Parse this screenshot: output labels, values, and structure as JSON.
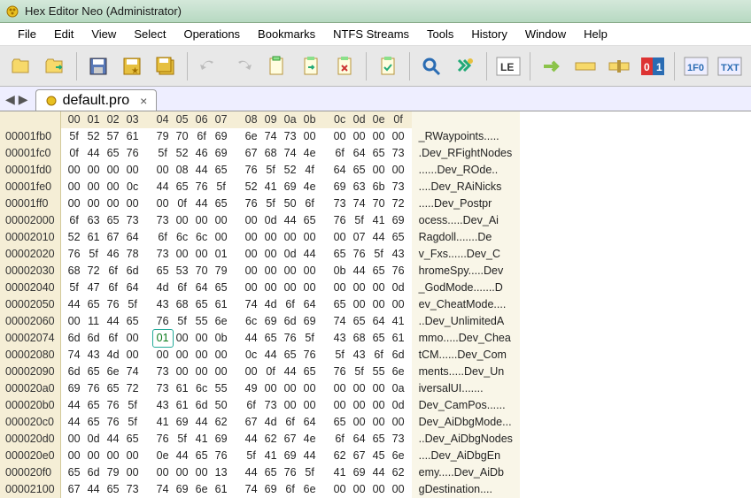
{
  "title": "Hex Editor Neo (Administrator)",
  "menu": [
    "File",
    "Edit",
    "View",
    "Select",
    "Operations",
    "Bookmarks",
    "NTFS Streams",
    "Tools",
    "History",
    "Window",
    "Help"
  ],
  "tab": {
    "label": "default.pro"
  },
  "col_headers": [
    "00",
    "01",
    "02",
    "03",
    "04",
    "05",
    "06",
    "07",
    "08",
    "09",
    "0a",
    "0b",
    "0c",
    "0d",
    "0e",
    "0f"
  ],
  "selected": {
    "row": 11,
    "col": 4
  },
  "rows": [
    {
      "o": "00001fb0",
      "h": [
        "5f",
        "52",
        "57",
        "61",
        "79",
        "70",
        "6f",
        "69",
        "6e",
        "74",
        "73",
        "00",
        "00",
        "00",
        "00",
        "00"
      ],
      "a": "_RWaypoints....."
    },
    {
      "o": "00001fc0",
      "h": [
        "0f",
        "44",
        "65",
        "76",
        "5f",
        "52",
        "46",
        "69",
        "67",
        "68",
        "74",
        "4e",
        "6f",
        "64",
        "65",
        "73"
      ],
      "a": ".Dev_RFightNodes"
    },
    {
      "o": "00001fd0",
      "h": [
        "00",
        "00",
        "00",
        "00",
        "00",
        "08",
        "44",
        "65",
        "76",
        "5f",
        "52",
        "4f",
        "64",
        "65",
        "00",
        "00"
      ],
      "a": "......Dev_ROde.."
    },
    {
      "o": "00001fe0",
      "h": [
        "00",
        "00",
        "00",
        "0c",
        "44",
        "65",
        "76",
        "5f",
        "52",
        "41",
        "69",
        "4e",
        "69",
        "63",
        "6b",
        "73"
      ],
      "a": "....Dev_RAiNicks"
    },
    {
      "o": "00001ff0",
      "h": [
        "00",
        "00",
        "00",
        "00",
        "00",
        "0f",
        "44",
        "65",
        "76",
        "5f",
        "50",
        "6f",
        "73",
        "74",
        "70",
        "72"
      ],
      "a": ".....Dev_Postpr"
    },
    {
      "o": "00002000",
      "h": [
        "6f",
        "63",
        "65",
        "73",
        "73",
        "00",
        "00",
        "00",
        "00",
        "0d",
        "44",
        "65",
        "76",
        "5f",
        "41",
        "69"
      ],
      "a": "ocess.....Dev_Ai"
    },
    {
      "o": "00002010",
      "h": [
        "52",
        "61",
        "67",
        "64",
        "6f",
        "6c",
        "6c",
        "00",
        "00",
        "00",
        "00",
        "00",
        "00",
        "07",
        "44",
        "65"
      ],
      "a": "Ragdoll.......De"
    },
    {
      "o": "00002020",
      "h": [
        "76",
        "5f",
        "46",
        "78",
        "73",
        "00",
        "00",
        "01",
        "00",
        "00",
        "0d",
        "44",
        "65",
        "76",
        "5f",
        "43"
      ],
      "a": "v_Fxs......Dev_C"
    },
    {
      "o": "00002030",
      "h": [
        "68",
        "72",
        "6f",
        "6d",
        "65",
        "53",
        "70",
        "79",
        "00",
        "00",
        "00",
        "00",
        "0b",
        "44",
        "65",
        "76"
      ],
      "a": "hromeSpy.....Dev"
    },
    {
      "o": "00002040",
      "h": [
        "5f",
        "47",
        "6f",
        "64",
        "4d",
        "6f",
        "64",
        "65",
        "00",
        "00",
        "00",
        "00",
        "00",
        "00",
        "00",
        "0d"
      ],
      "a": "_GodMode.......D"
    },
    {
      "o": "00002050",
      "h": [
        "44",
        "65",
        "76",
        "5f",
        "43",
        "68",
        "65",
        "61",
        "74",
        "4d",
        "6f",
        "64",
        "65",
        "00",
        "00",
        "00"
      ],
      "a": "ev_CheatMode...."
    },
    {
      "o": "00002060",
      "h": [
        "00",
        "11",
        "44",
        "65",
        "76",
        "5f",
        "55",
        "6e",
        "6c",
        "69",
        "6d",
        "69",
        "74",
        "65",
        "64",
        "41"
      ],
      "a": "..Dev_UnlimitedA"
    },
    {
      "o": "00002074",
      "h": [
        "6d",
        "6d",
        "6f",
        "00",
        "01",
        "00",
        "00",
        "0b",
        "44",
        "65",
        "76",
        "5f",
        "43",
        "68",
        "65",
        "61"
      ],
      "a": "mmo.....Dev_Chea"
    },
    {
      "o": "00002080",
      "h": [
        "74",
        "43",
        "4d",
        "00",
        "00",
        "00",
        "00",
        "00",
        "0c",
        "44",
        "65",
        "76",
        "5f",
        "43",
        "6f",
        "6d"
      ],
      "a": "tCM......Dev_Com"
    },
    {
      "o": "00002090",
      "h": [
        "6d",
        "65",
        "6e",
        "74",
        "73",
        "00",
        "00",
        "00",
        "00",
        "0f",
        "44",
        "65",
        "76",
        "5f",
        "55",
        "6e"
      ],
      "a": "ments.....Dev_Un"
    },
    {
      "o": "000020a0",
      "h": [
        "69",
        "76",
        "65",
        "72",
        "73",
        "61",
        "6c",
        "55",
        "49",
        "00",
        "00",
        "00",
        "00",
        "00",
        "00",
        "0a"
      ],
      "a": "iversalUI......."
    },
    {
      "o": "000020b0",
      "h": [
        "44",
        "65",
        "76",
        "5f",
        "43",
        "61",
        "6d",
        "50",
        "6f",
        "73",
        "00",
        "00",
        "00",
        "00",
        "00",
        "0d"
      ],
      "a": "Dev_CamPos......"
    },
    {
      "o": "000020c0",
      "h": [
        "44",
        "65",
        "76",
        "5f",
        "41",
        "69",
        "44",
        "62",
        "67",
        "4d",
        "6f",
        "64",
        "65",
        "00",
        "00",
        "00"
      ],
      "a": "Dev_AiDbgMode..."
    },
    {
      "o": "000020d0",
      "h": [
        "00",
        "0d",
        "44",
        "65",
        "76",
        "5f",
        "41",
        "69",
        "44",
        "62",
        "67",
        "4e",
        "6f",
        "64",
        "65",
        "73"
      ],
      "a": "..Dev_AiDbgNodes"
    },
    {
      "o": "000020e0",
      "h": [
        "00",
        "00",
        "00",
        "00",
        "0e",
        "44",
        "65",
        "76",
        "5f",
        "41",
        "69",
        "44",
        "62",
        "67",
        "45",
        "6e"
      ],
      "a": "....Dev_AiDbgEn"
    },
    {
      "o": "000020f0",
      "h": [
        "65",
        "6d",
        "79",
        "00",
        "00",
        "00",
        "00",
        "13",
        "44",
        "65",
        "76",
        "5f",
        "41",
        "69",
        "44",
        "62"
      ],
      "a": "emy.....Dev_AiDb"
    },
    {
      "o": "00002100",
      "h": [
        "67",
        "44",
        "65",
        "73",
        "74",
        "69",
        "6e",
        "61",
        "74",
        "69",
        "6f",
        "6e",
        "00",
        "00",
        "00",
        "00"
      ],
      "a": "gDestination...."
    }
  ],
  "icons": {
    "open": "open-icon",
    "recent": "recent-icon",
    "save": "save-icon",
    "saveall": "saveall-icon",
    "saveas": "saveas-icon",
    "undo": "undo-icon",
    "redo": "redo-icon",
    "copy": "copy-icon",
    "paste": "paste-icon",
    "cut": "cut-icon",
    "edit": "edit-icon",
    "find": "find-icon",
    "replace": "replace-icon",
    "encoding": "le-icon",
    "run": "run-icon",
    "ins1": "insert-icon",
    "ins2": "insert-icon",
    "toggle": "toggle-icon",
    "hexview": "hexview-icon",
    "txtview": "txtview-icon"
  }
}
